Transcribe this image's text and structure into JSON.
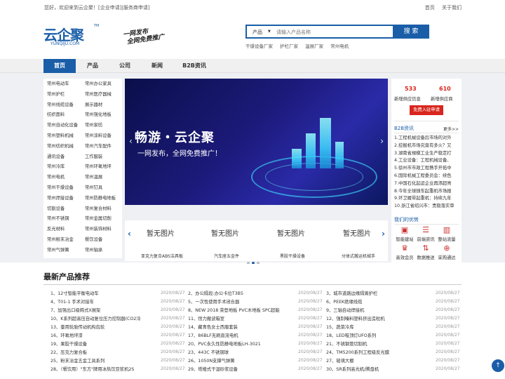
{
  "topbar": {
    "welcome": "您好，欢迎来到云企聚！[企业申请]|服务商申请]",
    "home": "首页",
    "about": "关于我们"
  },
  "logo": {
    "text": "云企聚",
    "sub": "YUNQIJU.COM",
    "tm": "TM"
  },
  "slogan": {
    "line1": "一网发布",
    "line2": "全网免费推广"
  },
  "search": {
    "category": "产品",
    "placeholder": "请输入产品名称",
    "button": "搜 索"
  },
  "hotwords": [
    "干燥设备厂家",
    "护栏厂家",
    "温展厂家",
    "常州电机"
  ],
  "nav": [
    "首页",
    "产品",
    "公司",
    "新闻",
    "B2B资讯"
  ],
  "categories": [
    "常州电动车",
    "常州办公家具",
    "常州护栏",
    "常州医疗器械",
    "常州线缆设备",
    "展示器材",
    "纺织面料",
    "常州强化地板",
    "常州自动化设备",
    "常州家纺",
    "常州塑料机械",
    "常州涂料设备",
    "常州纺织机械",
    "常州汽车配件",
    "通讯设备",
    "工作服装",
    "常州冷库",
    "常州环氧地坪",
    "常州电机",
    "常州温展",
    "常州干燥设备",
    "常州钉具",
    "常州焊接设备",
    "常州防静电地板",
    "切割设备",
    "常州复合材料",
    "常州不锈钢",
    "常州金属切削",
    "反光材料",
    "常州装饰材料",
    "常州粉末冶金",
    "餐饮设备",
    "常州气弹簧",
    "常州轴承"
  ],
  "banner": {
    "title": "畅游・云企聚",
    "subtitle": "一网发布，全网免费推广！",
    "prev": "‹",
    "next": "›"
  },
  "thumbs": {
    "placeholder": "暂无图片",
    "captions": [
      "亚克力复合ABS洁具板",
      "汽车座五金件",
      "黑胶干燥设备",
      "分体式搬运机械手"
    ],
    "prev": "‹",
    "next": "›"
  },
  "side": {
    "supply_num": "533",
    "supply_label": "新增供应信息",
    "company_num": "610",
    "company_label": "新增供应商",
    "join": "免费入驻申请",
    "b2b_title": "B2B资讯",
    "more": "更多>>",
    "news": [
      "1.工程机械设备后市场的对外",
      "2.挖掘机市场究竟有多火？又",
      "3.湖南省規模工业生产稳定打",
      "4.工业设备：工程机械设备、",
      "5.徐州市市政工程携手开拓中",
      "6.国际机械工程委员会：续色",
      "7.中国石化起运企业再添超亮",
      "8.今年全球随车起重机市场报",
      "9.环卫履带起重机：持续九年",
      "10.浙江省绍兴市：贵稳落实审"
    ],
    "adv_title": "我们的优势",
    "adv": [
      "智能建站",
      "前端资讯",
      "整站流量",
      "高效会员",
      "数据推送",
      "采购通达"
    ]
  },
  "section": {
    "title": "最新产品推荐"
  },
  "products": [
    [
      "1、12寸智能平衡电动车",
      "2020/08/27",
      "2、办公隔段:办公卡位T3B5",
      "2020/08/27",
      "3、城市道路边缘隔离护栏",
      "2020/08/27"
    ],
    [
      "4、T01-1 手术对接车",
      "2020/08/27",
      "5、一次性使用手术闭合器",
      "2020/08/27",
      "6、PEEK绝缘线缆",
      "2020/08/27"
    ],
    [
      "7、加强出口级韩式X展架",
      "2020/08/27",
      "8、NEW 2018 荣登地板 PVC木地板 SPC超能",
      "2020/08/27",
      "9、三轴自动焊接机",
      "2020/08/27"
    ],
    [
      "10、K系列超高压自动复位压力控制器(CO2冷",
      "2020/08/27",
      "11、恒力搬波箱室",
      "2020/08/27",
      "12、强制嗪料塑料挤出造粒机",
      "2020/08/27"
    ],
    [
      "13、臺用轮胎传动机构齿轮",
      "2020/08/27",
      "14、藏青色女士西服套装",
      "2020/08/27",
      "15、蔬菜冷库",
      "2020/08/27"
    ],
    [
      "16、环氧地坪漆",
      "2020/08/27",
      "17、86BLF无刷直流电机",
      "2020/08/27",
      "18、LED吸顶灯UFO系列",
      "2020/08/27"
    ],
    [
      "19、果胶干燥设备",
      "2020/08/27",
      "20、PVC永久性防静电地板LH-3021",
      "2020/08/27",
      "21、不锈钢管切割机",
      "2020/08/27"
    ],
    [
      "22、压克力复合板",
      "2020/08/27",
      "23、443C 不锈钢球",
      "2020/08/27",
      "24、TM5200系列工程级反光膜",
      "2020/08/27"
    ],
    [
      "25、粉末冶金五金工具系列",
      "2020/08/27",
      "26、1050N支撑气弹簧",
      "2020/08/27",
      "27、玻璃大棚",
      "2020/08/27"
    ],
    [
      "28、（餐饮用）\"东方\"牌用冰热饮豆浆机2S",
      "2020/08/27",
      "29、塔楼式干湿砂浆设备",
      "2020/08/27",
      "30、SR系列高光机/腾盘机",
      "2020/08/27"
    ]
  ],
  "totop": "↑",
  "colors": {
    "brand": "#1a5ea8",
    "accent": "#d8251d"
  }
}
